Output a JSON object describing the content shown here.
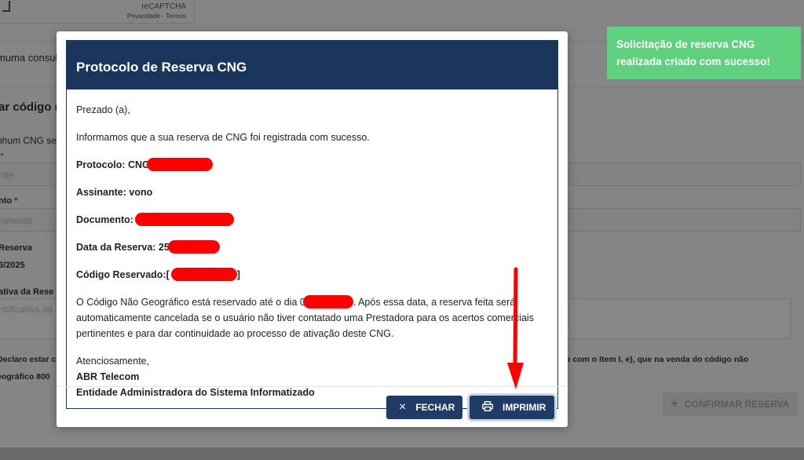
{
  "background": {
    "captcha_brand": "reCAPTCHA",
    "captcha_links": "Privacidade - Termos",
    "consult_text": "muma consulta",
    "section_title": "ar código n",
    "none_text": "nhum CNG se",
    "field1_label": "*",
    "field1_placeholder": "nte",
    "field2_label": "nto",
    "field2_required": "*",
    "field2_placeholder": "umento",
    "field3_label": "Reserva",
    "field3_value": "6/2025",
    "field4_label": "ativa da Rese",
    "field4_placeholder": "stificativa da",
    "declare_left": "Declaro estar c",
    "declare_right": "o com o Item I, e), que na venda do código não",
    "declare_left_2": "eográfico 800",
    "confirm_label": "CONFIRMAR RESERVA",
    "confirm_icon": "+"
  },
  "toast": {
    "message": "Solicitação de reserva CNG realizada criado com sucesso!"
  },
  "modal": {
    "title": "Protocolo de Reserva CNG",
    "greeting": "Prezado (a),",
    "intro": "Informamos que a sua reserva de CNG foi registrada com sucesso.",
    "protocolo_label": "Protocolo: CNG",
    "assinante": "Assinante: vono",
    "documento_label": "Documento:",
    "data_label": "Data da Reserva: 25",
    "codigo_label": "Código Reservado:[",
    "codigo_close": "]",
    "notice_line1_a": "O Código Não Geográfico está reservado até o dia 0",
    "notice_line1_b": ". Após essa data, a reserva feita será",
    "notice_line2": "automaticamente cancelada se o usuário não tiver contatado uma Prestadora para os acertos comerciais",
    "notice_line3": "pertinentes e para dar continuidade ao processo de ativação deste CNG.",
    "closing": "Atenciosamente,",
    "org": "ABR Telecom",
    "org_sub": "Entidade Administradora do Sistema Informatizado",
    "btn_close": "FECHAR",
    "btn_close_icon": "×",
    "btn_print": "IMPRIMIR"
  },
  "colors": {
    "header": "#1b365d",
    "button": "#1f3b66",
    "toast": "#5fd07d",
    "annotation": "#ff0000"
  }
}
